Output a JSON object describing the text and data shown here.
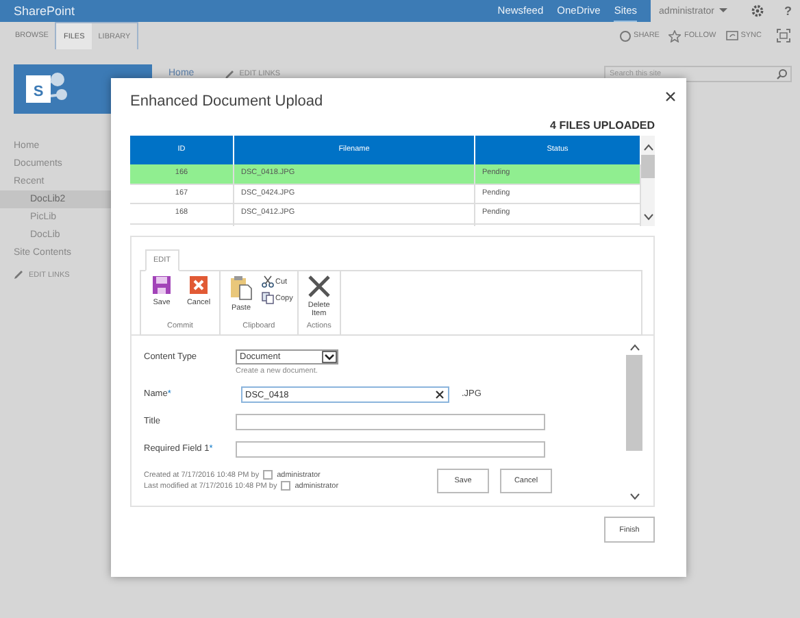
{
  "top_bar": {
    "brand": "SharePoint",
    "links": [
      {
        "label": "Newsfeed",
        "selected": false
      },
      {
        "label": "OneDrive",
        "selected": false
      },
      {
        "label": "Sites",
        "selected": true
      }
    ],
    "user": "administrator",
    "help": "?"
  },
  "ribbon_tabs": [
    {
      "label": "BROWSE",
      "selected": false,
      "contextual": false
    },
    {
      "label": "FILES",
      "selected": true,
      "contextual": true
    },
    {
      "label": "LIBRARY",
      "selected": false,
      "contextual": true
    }
  ],
  "ribbon_actions": [
    {
      "label": "SHARE",
      "kind": "share"
    },
    {
      "label": "FOLLOW",
      "kind": "follow"
    },
    {
      "label": "SYNC",
      "kind": "sync"
    }
  ],
  "logo": {
    "letter": "S"
  },
  "top_nav": {
    "home": "Home",
    "edit_links": "EDIT LINKS"
  },
  "search": {
    "placeholder": "Search this site"
  },
  "sidebar": {
    "items": [
      {
        "label": "Home",
        "selected": false
      },
      {
        "label": "Documents",
        "selected": false
      },
      {
        "label": "Recent",
        "selected": false,
        "children": [
          {
            "label": "DocLib2",
            "selected": true
          },
          {
            "label": "PicLib",
            "selected": false
          },
          {
            "label": "DocLib",
            "selected": false
          }
        ]
      },
      {
        "label": "Site Contents",
        "selected": false
      }
    ],
    "edit_links": "EDIT LINKS"
  },
  "dialog": {
    "title": "Enhanced Document Upload",
    "summary": "4 FILES UPLOADED",
    "table": {
      "columns": [
        "ID",
        "Filename",
        "Status"
      ],
      "rows": [
        {
          "cells": [
            "166",
            "DSC_0418.JPG",
            "Pending"
          ],
          "selected": true
        },
        {
          "cells": [
            "167",
            "DSC_0424.JPG",
            "Pending"
          ],
          "selected": false
        },
        {
          "cells": [
            "168",
            "DSC_0412.JPG",
            "Pending"
          ],
          "selected": false
        }
      ]
    },
    "ribbon": {
      "tab": "EDIT",
      "groups": [
        {
          "label": "Commit",
          "buttons": [
            {
              "label": "Save",
              "kind": "save"
            },
            {
              "label": "Cancel",
              "kind": "cancel"
            }
          ]
        },
        {
          "label": "Clipboard",
          "buttons": [
            {
              "label": "Paste",
              "kind": "paste"
            },
            {
              "label": "Cut",
              "kind": "cut"
            },
            {
              "label": "Copy",
              "kind": "copy"
            }
          ]
        },
        {
          "label": "Actions",
          "buttons": [
            {
              "label": "Delete Item",
              "kind": "delete"
            }
          ]
        }
      ]
    },
    "form": {
      "fields": [
        {
          "label": "Content Type",
          "kind": "select",
          "value": "Document",
          "hint": "Create a new document."
        },
        {
          "label": "Name",
          "required_mark": "*",
          "kind": "text",
          "value": "DSC_0418",
          "suffix": ".JPG",
          "focused": true
        },
        {
          "label": "Title",
          "kind": "text",
          "focused": false
        },
        {
          "label": "Required Field 1",
          "required_mark": "*",
          "kind": "text",
          "focused": false
        }
      ],
      "meta": [
        {
          "text": "Created at 7/17/2016 10:48 PM  by",
          "user": "administrator"
        },
        {
          "text": "Last modified at 7/17/2016 10:48 PM  by",
          "user": "administrator"
        }
      ],
      "buttons": [
        "Save",
        "Cancel"
      ]
    },
    "finish": "Finish"
  }
}
